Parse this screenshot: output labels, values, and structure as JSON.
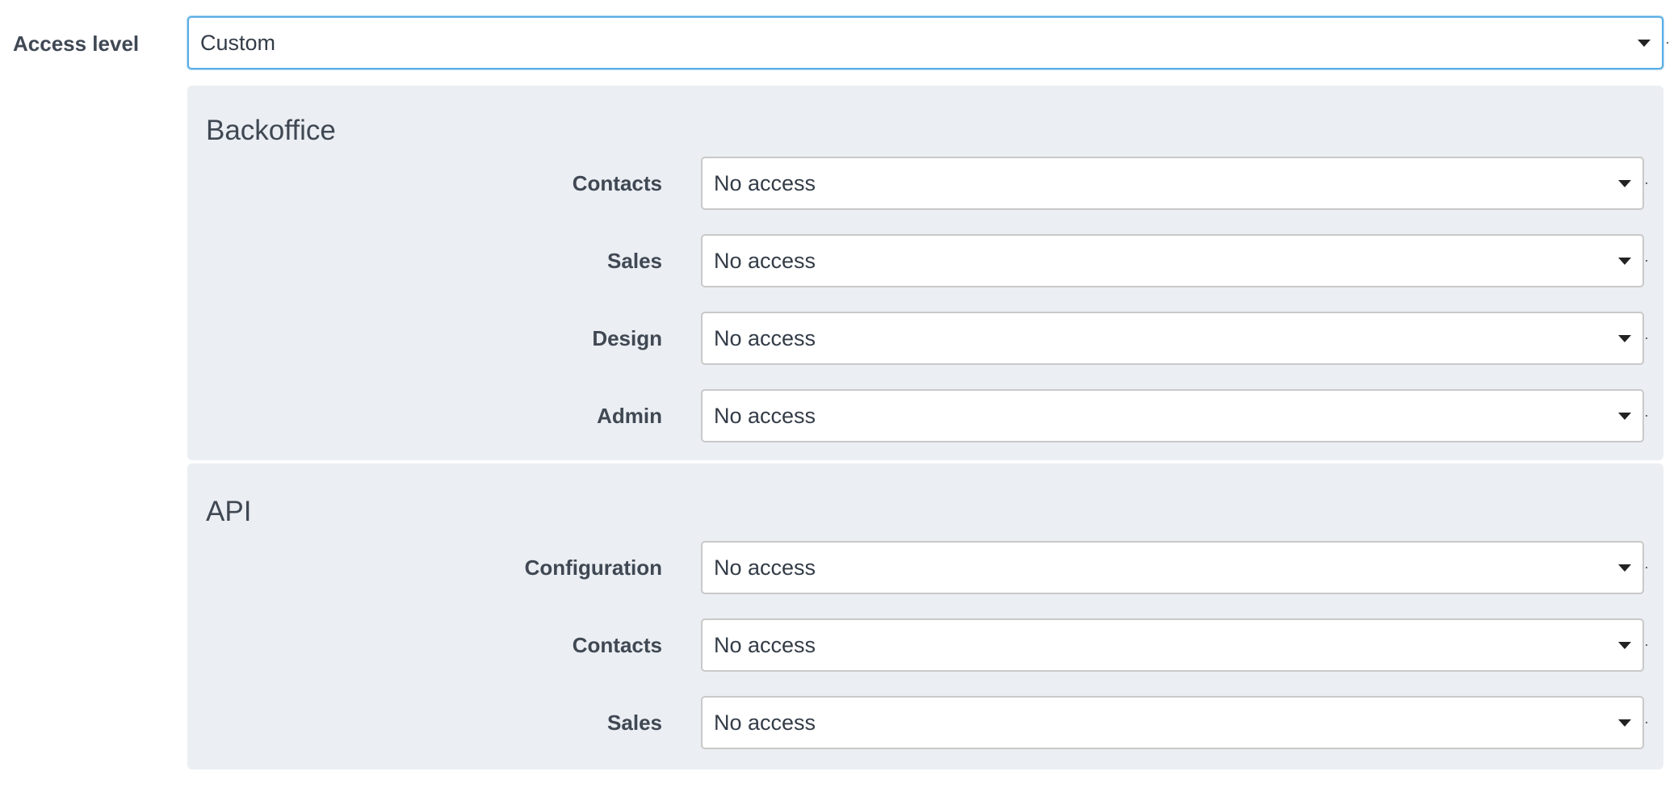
{
  "access_level": {
    "label": "Access level",
    "value": "Custom"
  },
  "sections": [
    {
      "title": "Backoffice",
      "fields": [
        {
          "label": "Contacts",
          "value": "No access"
        },
        {
          "label": "Sales",
          "value": "No access"
        },
        {
          "label": "Design",
          "value": "No access"
        },
        {
          "label": "Admin",
          "value": "No access"
        }
      ]
    },
    {
      "title": "API",
      "fields": [
        {
          "label": "Configuration",
          "value": "No access"
        },
        {
          "label": "Contacts",
          "value": "No access"
        },
        {
          "label": "Sales",
          "value": "No access"
        }
      ]
    }
  ],
  "icons": {
    "dropdown": "caret-down-icon"
  },
  "colors": {
    "panel_background": "#ebeef2",
    "focus_border": "#5aaee5",
    "text": "#3f4853"
  }
}
